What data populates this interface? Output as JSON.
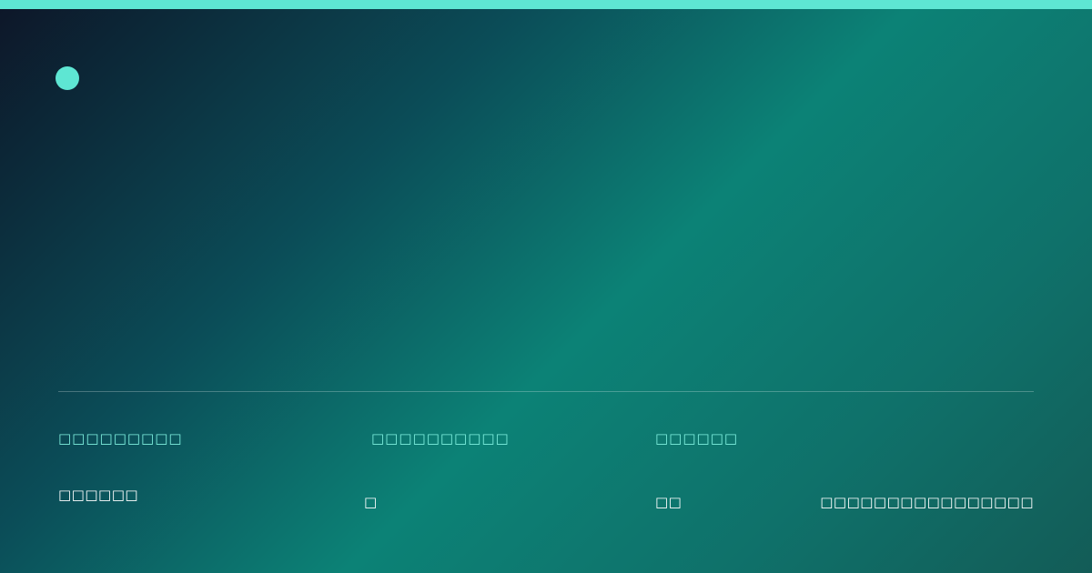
{
  "colors": {
    "accent": "#5ee6d3",
    "label": "#7ff0df",
    "text": "#ffffff"
  },
  "info": {
    "labels": [
      "□□□□□□□□□",
      "□□□□□□□□□□",
      "□□□□□□"
    ],
    "values": [
      "□□□□□□",
      "□",
      "□□",
      "□□□□□□□□□□□□□□□□"
    ]
  }
}
